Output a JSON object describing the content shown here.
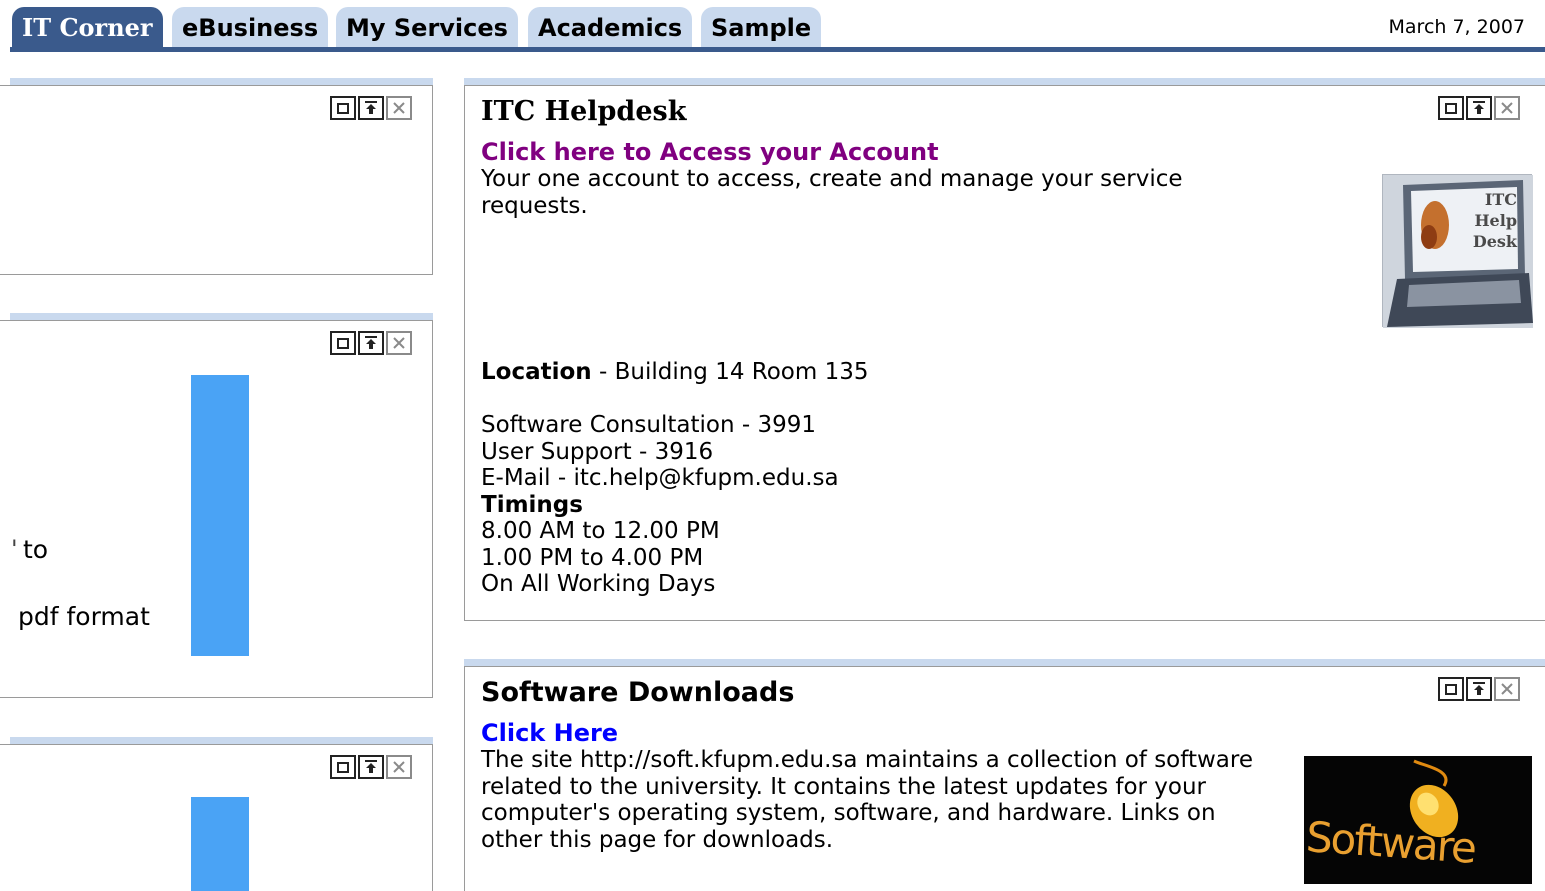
{
  "tabs": [
    {
      "label": "IT Corner",
      "active": true
    },
    {
      "label": "eBusiness"
    },
    {
      "label": "My Services"
    },
    {
      "label": "Academics"
    },
    {
      "label": "Sample"
    }
  ],
  "date": "March 7, 2007",
  "left_portlets": {
    "fragment_1": "to",
    "fragment_2": "pdf format"
  },
  "helpdesk": {
    "title": "ITC Helpdesk",
    "link": "Click here to Access your Account",
    "description": "Your one account to access, create and manage your service requests.",
    "location_label": "Location",
    "location_value": " - Building 14 Room 135",
    "contacts": [
      "Software Consultation - 3991",
      "User Support - 3916",
      "E-Mail - itc.help@kfupm.edu.sa"
    ],
    "timings_label": "Timings",
    "timings": [
      "8.00 AM to 12.00 PM",
      "1.00 PM to 4.00 PM",
      "On All Working Days"
    ],
    "image_text": [
      "ITC",
      "Help",
      "Desk"
    ]
  },
  "software": {
    "title": "Software Downloads",
    "link": "Click Here",
    "description": "The site http://soft.kfupm.edu.sa maintains a collection of software related to the university. It contains the latest updates for your computer's operating system, software, and hardware. Links on other this page for downloads.",
    "image_text": "Software"
  },
  "colors": {
    "tab_active": "#3a5a8c",
    "tab_inactive": "#c9d9ee",
    "visited_link": "#800080",
    "link": "#0000ff",
    "bar": "#4aa3f5"
  },
  "icons": [
    "maximize-icon",
    "minimize-icon",
    "close-icon"
  ]
}
